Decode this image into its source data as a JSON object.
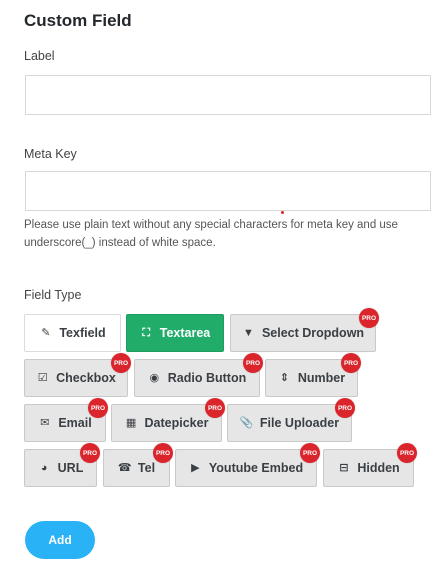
{
  "form": {
    "title": "Custom Field",
    "label_label": "Label",
    "label_value": "",
    "meta_key_label": "Meta Key",
    "meta_key_value": "",
    "help_text": "Please use plain text without any special characters for meta key and use underscore(_) instead of white space.",
    "field_type_label": "Field Type",
    "add_label": "Add"
  },
  "field_types": [
    {
      "label": "Texfield",
      "icon": "edit-icon",
      "pro": false,
      "state": "default"
    },
    {
      "label": "Textarea",
      "icon": "expand-icon",
      "pro": false,
      "state": "selected"
    },
    {
      "label": "Select Dropdown",
      "icon": "dropdown-icon",
      "pro": true
    },
    {
      "label": "Checkbox",
      "icon": "checkbox-icon",
      "pro": true
    },
    {
      "label": "Radio Button",
      "icon": "radio-icon",
      "pro": true
    },
    {
      "label": "Number",
      "icon": "sort-icon",
      "pro": true
    },
    {
      "label": "Email",
      "icon": "envelope-icon",
      "pro": true
    },
    {
      "label": "Datepicker",
      "icon": "calendar-icon",
      "pro": true
    },
    {
      "label": "File Uploader",
      "icon": "paperclip-icon",
      "pro": true
    },
    {
      "label": "URL",
      "icon": "globe-icon",
      "pro": true
    },
    {
      "label": "Tel",
      "icon": "phone-icon",
      "pro": true
    },
    {
      "label": "Youtube Embed",
      "icon": "youtube-icon",
      "pro": true
    },
    {
      "label": "Hidden",
      "icon": "minus-square-icon",
      "pro": true
    }
  ],
  "pro_badge": "PRO",
  "colors": {
    "selected": "#21ad69",
    "pro_badge": "#d9252b",
    "add_button": "#2ab2f6"
  }
}
